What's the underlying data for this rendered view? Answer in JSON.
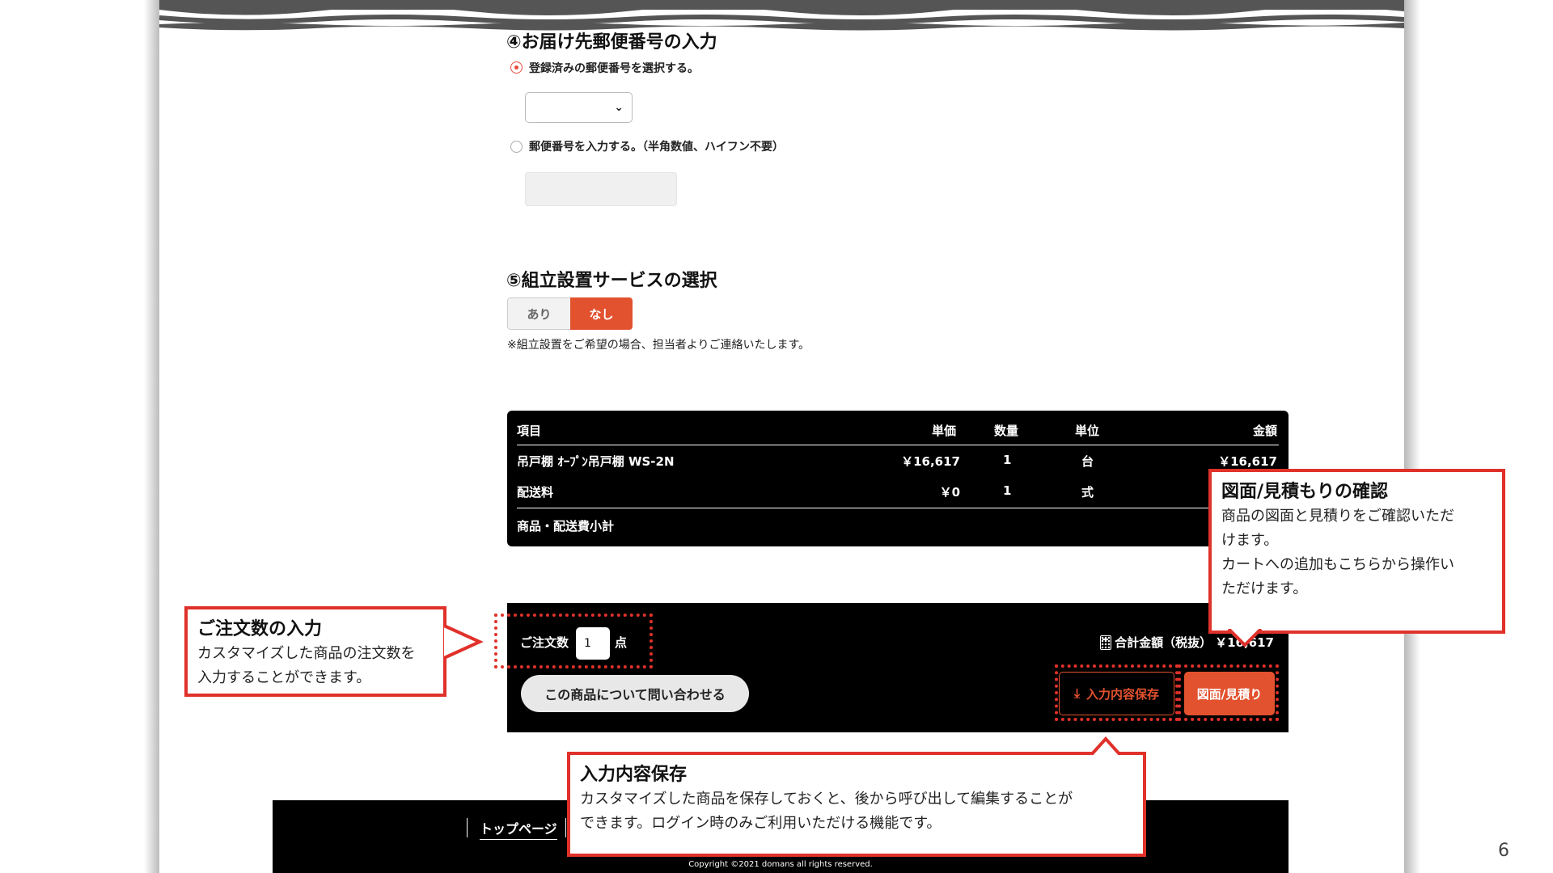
{
  "slide_number": "6",
  "postal": {
    "section_title": "④お届け先郵便番号の入力",
    "option_registered": "登録済みの郵便番号を選択する。",
    "option_manual": "郵便番号を入力する。（半角数値、ハイフン不要）",
    "selected_option": "registered"
  },
  "assembly": {
    "section_title": "⑤組立設置サービスの選択",
    "option_yes": "あり",
    "option_no": "なし",
    "selected": "なし",
    "note": "※組立設置をご希望の場合、担当者よりご連絡いたします。"
  },
  "table": {
    "headers": {
      "item": "項目",
      "unit_price": "単価",
      "quantity": "数量",
      "unit": "単位",
      "amount": "金額"
    },
    "rows": [
      {
        "item": "吊戸棚 ｵｰﾌﾟﾝ吊戸棚 WS-2N",
        "unit_price": "￥16,617",
        "quantity": "1",
        "unit": "台",
        "amount": "￥16,617"
      },
      {
        "item": "配送料",
        "unit_price": "￥0",
        "quantity": "1",
        "unit": "式",
        "amount": ""
      }
    ],
    "subtotal_label": "商品・配送費小計"
  },
  "order": {
    "qty_label": "ご注文数",
    "qty_value": "1",
    "qty_unit": "点",
    "total_label": "合計金額（税抜）",
    "total_value": "￥16,617",
    "inquiry_button": "この商品について問い合わせる",
    "save_button": "入力内容保存",
    "estimate_button": "図面/見積り"
  },
  "callouts": {
    "estimate": {
      "title": "図面/見積もりの確認",
      "body1": "商品の図面と見積りをご確認いただ",
      "body2": "けます。",
      "body3": "カートへの追加もこちらから操作い",
      "body4": "ただけます。"
    },
    "quantity": {
      "title": "ご注文数の入力",
      "body1": "カスタマイズした商品の注文数を",
      "body2": "入力することができます。"
    },
    "save": {
      "title": "入力内容保存",
      "body1": "カスタマイズした商品を保存しておくと、後から呼び出して編集することが",
      "body2": "できます。ログイン時のみご利用いただける機能です。"
    }
  },
  "footer": {
    "top_link": "トップページ",
    "copyright": "Copyright ©2021 domans all rights reserved."
  },
  "colors": {
    "accent": "#e2522f",
    "callout_border": "#e0312a",
    "dark": "#000000"
  }
}
